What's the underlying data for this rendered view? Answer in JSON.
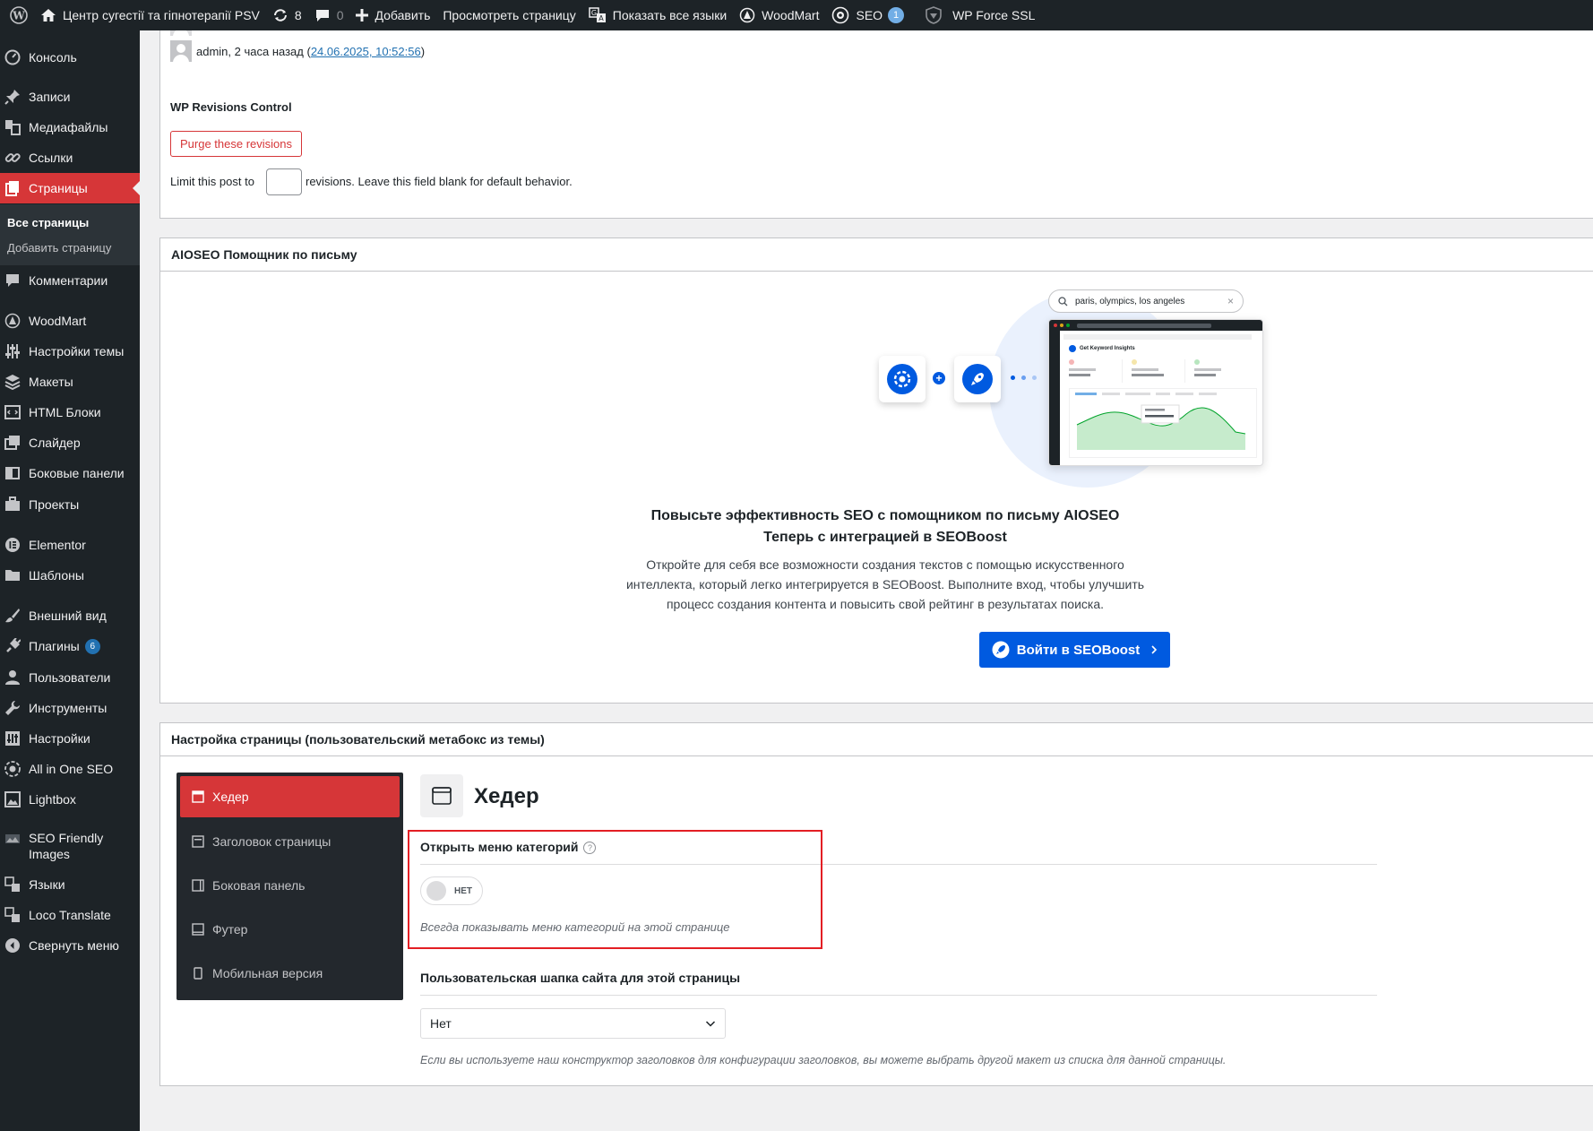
{
  "adminbar": {
    "site_name": "Центр сугестії та гіпнотерапії PSV",
    "updates_count": "8",
    "comments_count": "0",
    "add_new": "Добавить",
    "view_page": "Просмотреть страницу",
    "show_all_languages": "Показать все языки",
    "woodmart": "WoodMart",
    "seo": "SEO",
    "seo_badge": "1",
    "force_ssl": "WP Force SSL"
  },
  "sidebar": {
    "items": [
      {
        "label": "Консоль",
        "icon": "dashboard-icon"
      },
      {
        "label": "Записи",
        "icon": "pin-icon"
      },
      {
        "label": "Медиафайлы",
        "icon": "media-icon"
      },
      {
        "label": "Ссылки",
        "icon": "link-icon"
      },
      {
        "label": "Страницы",
        "icon": "pages-icon"
      },
      {
        "label": "Комментарии",
        "icon": "comment-icon"
      },
      {
        "label": "WoodMart",
        "icon": "woodmart-icon"
      },
      {
        "label": "Настройки темы",
        "icon": "sliders-icon"
      },
      {
        "label": "Макеты",
        "icon": "layers-icon"
      },
      {
        "label": "HTML Блоки",
        "icon": "html-icon"
      },
      {
        "label": "Слайдер",
        "icon": "slider-icon"
      },
      {
        "label": "Боковые панели",
        "icon": "sidebar-icon"
      },
      {
        "label": "Проекты",
        "icon": "briefcase-icon"
      },
      {
        "label": "Elementor",
        "icon": "elementor-icon"
      },
      {
        "label": "Шаблоны",
        "icon": "folder-icon"
      },
      {
        "label": "Внешний вид",
        "icon": "brush-icon"
      },
      {
        "label": "Плагины",
        "icon": "plugin-icon",
        "badge": "6"
      },
      {
        "label": "Пользователи",
        "icon": "user-icon"
      },
      {
        "label": "Инструменты",
        "icon": "wrench-icon"
      },
      {
        "label": "Настройки",
        "icon": "settings-icon"
      },
      {
        "label": "All in One SEO",
        "icon": "aioseo-icon"
      },
      {
        "label": "Lightbox",
        "icon": "lightbox-icon"
      },
      {
        "label": "SEO Friendly Images",
        "icon": "seo-images-icon"
      },
      {
        "label": "Языки",
        "icon": "translate-icon"
      },
      {
        "label": "Loco Translate",
        "icon": "loco-icon"
      },
      {
        "label": "Свернуть меню",
        "icon": "collapse-icon"
      }
    ],
    "submenu": {
      "all_pages": "Все страницы",
      "add_page": "Добавить страницу"
    }
  },
  "revisions": {
    "author_line": "admin, 2 часа назад (",
    "date_link": "24.06.2025, 10:52:56",
    "author_close": ")",
    "title": "WP Revisions Control",
    "purge_button": "Purge these revisions",
    "limit_prefix": "Limit this post to",
    "limit_suffix": "revisions. Leave this field blank for default behavior.",
    "limit_value": ""
  },
  "aioseo": {
    "header": "AIOSEO Помощник по письму",
    "search_text": "paris, olympics, los angeles",
    "mock_title": "Get Keyword Insights",
    "headline_1": "Повысьте эффективность SEO с помощником по письму AIOSEO",
    "headline_2": "Теперь с интеграцией в SEOBoost",
    "body_1": "Откройте для себя все возможности создания текстов с помощью искусственного",
    "body_2": "интеллекта, который легко интегрируется в SEOBoost. Выполните вход, чтобы улучшить",
    "body_3": "процесс создания контента и повысить свой рейтинг в результатах поиска.",
    "button": "Войти в SEOBoost"
  },
  "page_settings": {
    "header": "Настройка страницы (пользовательский метабокс из темы)",
    "tabs": [
      {
        "label": "Хедер",
        "icon": "header-icon"
      },
      {
        "label": "Заголовок страницы",
        "icon": "page-title-icon"
      },
      {
        "label": "Боковая панель",
        "icon": "sidebar-panel-icon"
      },
      {
        "label": "Футер",
        "icon": "footer-icon"
      },
      {
        "label": "Мобильная версия",
        "icon": "mobile-icon"
      }
    ],
    "section_title": "Хедер",
    "open_menu_label": "Открыть меню категорий",
    "toggle_value": "НЕТ",
    "open_menu_desc": "Всегда показывать меню категорий на этой странице",
    "custom_header_label": "Пользовательская шапка сайта для этой страницы",
    "custom_header_value": "Нет",
    "custom_header_desc": "Если вы используете наш конструктор заголовков для конфигурации заголовков, вы можете выбрать другой макет из списка для данной страницы."
  },
  "colors": {
    "accent_red": "#d63638",
    "aioseo_blue": "#005ae0",
    "admin_dark": "#1d2327",
    "highlight": "#e31e24"
  }
}
